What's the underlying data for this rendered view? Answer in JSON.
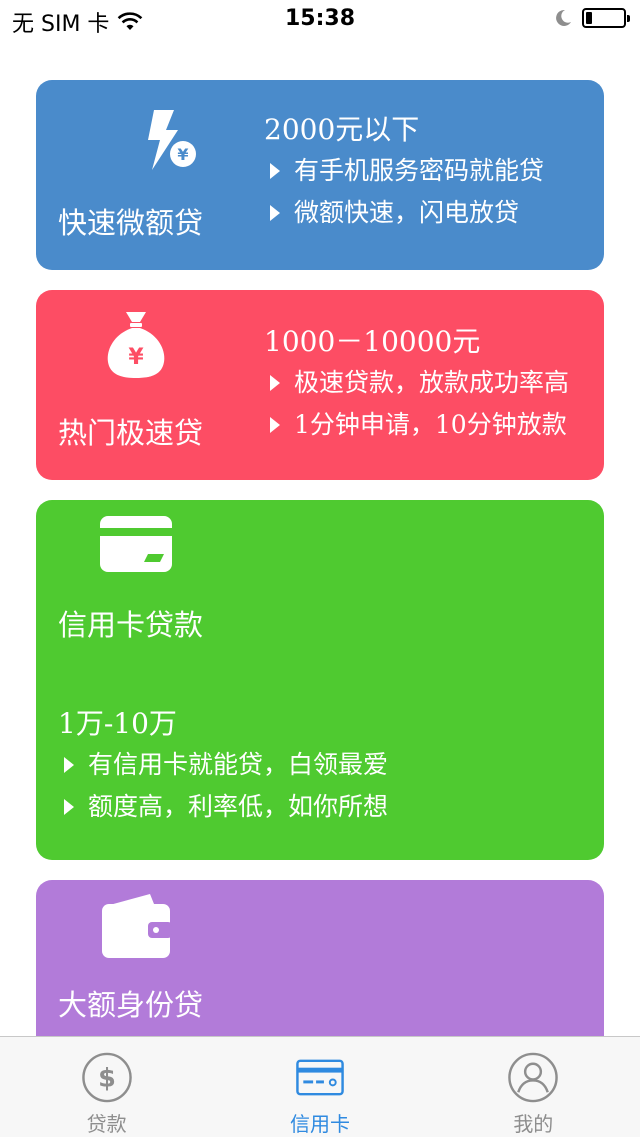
{
  "status_bar": {
    "carrier": "无 SIM 卡",
    "time": "15:38"
  },
  "cards": [
    {
      "name": "快速微额贷",
      "amount": "2000元以下",
      "features": [
        "有手机服务密码就能贷",
        "微额快速，闪电放贷"
      ],
      "color": "#4a8bcb",
      "icon": "lightning-yen-icon"
    },
    {
      "name": "热门极速贷",
      "amount": "1000－10000元",
      "features": [
        "极速贷款，放款成功率高",
        "1分钟申请，10分钟放款"
      ],
      "color": "#fd4d64",
      "icon": "money-bag-icon"
    },
    {
      "name": "信用卡贷款",
      "amount": "1万-10万",
      "features": [
        "有信用卡就能贷，白领最爱",
        "额度高，利率低，如你所想"
      ],
      "color": "#4fca30",
      "icon": "credit-card-icon"
    },
    {
      "name": "大额身份贷",
      "color": "#b27bd9",
      "icon": "wallet-icon"
    }
  ],
  "tabs": [
    {
      "label": "贷款",
      "icon": "dollar-circle-icon",
      "active": false
    },
    {
      "label": "信用卡",
      "icon": "card-icon",
      "active": true
    },
    {
      "label": "我的",
      "icon": "user-circle-icon",
      "active": false
    }
  ],
  "colors": {
    "tab_active": "#2f8ae0",
    "tab_inactive": "#8e8e8e"
  }
}
